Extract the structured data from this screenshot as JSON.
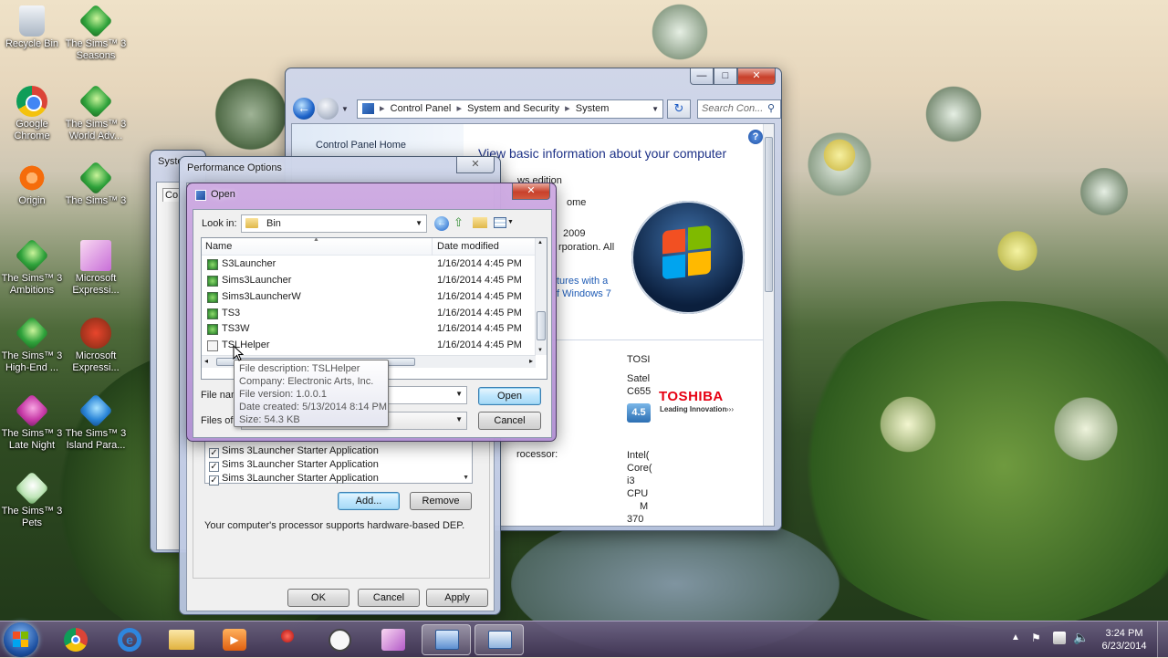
{
  "desktop": {
    "icons": [
      {
        "label": "Recycle Bin"
      },
      {
        "label": "The Sims™ 3 Seasons"
      },
      {
        "label": "Google Chrome"
      },
      {
        "label": "The Sims™ 3 World Adv..."
      },
      {
        "label": "Origin"
      },
      {
        "label": "The Sims™ 3"
      },
      {
        "label": "The Sims™ 3 Ambitions"
      },
      {
        "label": "Microsoft Expressi..."
      },
      {
        "label": "The Sims™ 3 High-End ..."
      },
      {
        "label": "Microsoft Expressi..."
      },
      {
        "label": "The Sims™ 3 Late Night"
      },
      {
        "label": "The Sims™ 3 Island Para..."
      },
      {
        "label": "The Sims™ 3 Pets"
      }
    ]
  },
  "system_window": {
    "address": [
      "Control Panel",
      "System and Security",
      "System"
    ],
    "search_placeholder": "Search Con...",
    "sidebar_link": "Control Panel Home",
    "heading": "View basic information about your computer",
    "edition_fragment": "ws edition",
    "home_fragment": "ome",
    "year_fragment": "2009",
    "corp_fragment": "rporation.  All",
    "link1_fragment": "tures with a",
    "link2_fragment": "f Windows 7",
    "mfr_fragment": "TOSI",
    "model_fragment1": "Satel",
    "model_fragment2": "C655",
    "rating": "4.5",
    "toshiba_brand": "TOSHIBA",
    "toshiba_tagline": "Leading Innovation",
    "processor_label": "rocessor:",
    "processor_lines": [
      "Intel(",
      "Core(",
      "i3",
      "CPU",
      "M",
      "370",
      "@"
    ]
  },
  "behind_window": {
    "title": "Syste",
    "tab": "Co"
  },
  "performance_options": {
    "title": "Performance Options",
    "programs": [
      "Sims 3Launcher Starter Application",
      "Sims 3Launcher Starter Application",
      "Sims 3Launcher Starter Application"
    ],
    "add_label": "Add...",
    "remove_label": "Remove",
    "dep_note": "Your computer's processor supports hardware-based DEP.",
    "ok_label": "OK",
    "cancel_label": "Cancel",
    "apply_label": "Apply"
  },
  "open_dialog": {
    "title": "Open",
    "look_in_label": "Look in:",
    "look_in_value": "Bin",
    "columns": {
      "name": "Name",
      "date": "Date modified"
    },
    "files": [
      {
        "name": "S3Launcher",
        "date": "1/16/2014 4:45 PM"
      },
      {
        "name": "Sims3Launcher",
        "date": "1/16/2014 4:45 PM"
      },
      {
        "name": "Sims3LauncherW",
        "date": "1/16/2014 4:45 PM"
      },
      {
        "name": "TS3",
        "date": "1/16/2014 4:45 PM"
      },
      {
        "name": "TS3W",
        "date": "1/16/2014 4:45 PM"
      },
      {
        "name": "TSLHelper",
        "date": "1/16/2014 4:45 PM"
      }
    ],
    "file_name_label": "File name",
    "files_of_type_label": "Files of ty",
    "open_label": "Open",
    "cancel_label": "Cancel",
    "tooltip": [
      "File description: TSLHelper",
      "Company: Electronic Arts, Inc.",
      "File version: 1.0.0.1",
      "Date created: 5/13/2014 8:14 PM",
      "Size: 54.3 KB"
    ]
  },
  "taskbar": {
    "time": "3:24 PM",
    "date": "6/23/2014"
  },
  "colors": {
    "link": "#1e5bb5",
    "heading": "#1e3287",
    "toshiba_red": "#e60012"
  }
}
